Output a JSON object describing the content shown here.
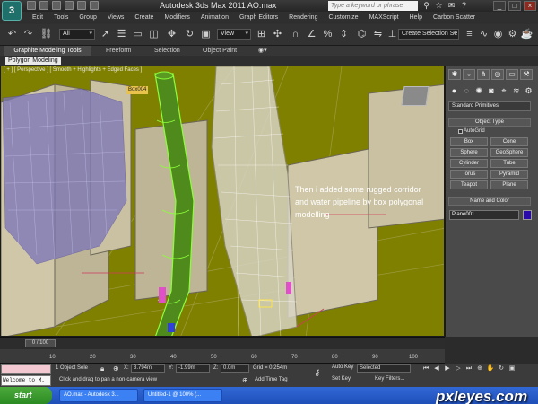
{
  "window": {
    "title": "Autodesk 3ds Max  2011      AO.max",
    "search_placeholder": "Type a keyword or phrase",
    "logo": "max-logo-icon",
    "win_controls": [
      "_",
      "□",
      "×"
    ]
  },
  "menu": [
    "Edit",
    "Tools",
    "Group",
    "Views",
    "Create",
    "Modifiers",
    "Animation",
    "Graph Editors",
    "Rendering",
    "Customize",
    "MAXScript",
    "Help",
    "Carbon Scatter"
  ],
  "toolbar": {
    "selection_filter": "All",
    "reference_coord": "View",
    "named_selection": "Create Selection Se"
  },
  "ribbon": {
    "tabs": [
      "Graphite Modeling Tools",
      "Freeform",
      "Selection",
      "Object Paint"
    ],
    "panel": "Polygon Modeling"
  },
  "viewport": {
    "label": "[ + ] [ Perspective ] [ Smooth + Highlights + Edged Faces ]",
    "object_tag": "Box004",
    "annotation": "Then i added some rugged corridor and water pipeline by box polygonal modelling",
    "bg_color": "#808000"
  },
  "command_panel": {
    "primitive_type": "Standard Primitives",
    "object_type_header": "Object Type",
    "autogrid": "AutoGrid",
    "buttons": [
      "Box",
      "Cone",
      "Sphere",
      "GeoSphere",
      "Cylinder",
      "Tube",
      "Torus",
      "Pyramid",
      "Teapot",
      "Plane"
    ],
    "name_color_header": "Name and Color",
    "object_name": "Plane001",
    "object_color": "#2a0aa8"
  },
  "timeline": {
    "frame_display": "0 / 100",
    "ticks": [
      "10",
      "20",
      "30",
      "40",
      "50",
      "60",
      "70",
      "80",
      "90",
      "100"
    ]
  },
  "status": {
    "listener_text": "Welcome to M.",
    "selection": "1 Object Sele",
    "prompt": "Click and drag to pan a non-camera view",
    "x_label": "X:",
    "x_value": "3.794m",
    "y_label": "Y:",
    "y_value": "-1.99m",
    "z_label": "Z:",
    "z_value": "0.0m",
    "grid": "Grid = 0.254m",
    "add_time_tag": "Add Time Tag",
    "auto_key": "Auto Key",
    "set_key": "Set Key",
    "key_mode": "Selected",
    "key_filters": "Key Filters..."
  },
  "taskbar": {
    "start": "start",
    "tasks": [
      "AO.max - Autodesk 3...",
      "Untitled-1 @ 100% (..."
    ]
  },
  "watermark": "pxleyes.com"
}
